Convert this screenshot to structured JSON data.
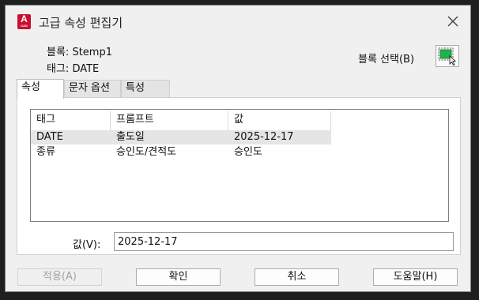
{
  "window": {
    "title": "고급 속성 편집기",
    "app_icon_letter": "A",
    "app_icon_sub": "CAD"
  },
  "info": {
    "block_label": "블록:",
    "block_value": "Stemp1",
    "tag_label": "태그:",
    "tag_value": "DATE"
  },
  "select_block": {
    "label": "블록 선택(B)",
    "icon": "select-objects-icon"
  },
  "tabs": [
    {
      "label": "속성",
      "active": true
    },
    {
      "label": "문자 옵션",
      "active": false
    },
    {
      "label": "특성",
      "active": false
    }
  ],
  "table": {
    "columns": [
      "태그",
      "프롬프트",
      "값"
    ],
    "rows": [
      {
        "tag": "DATE",
        "prompt": "출도일",
        "value": "2025-12-17",
        "selected": true
      },
      {
        "tag": "종류",
        "prompt": "승인도/견적도",
        "value": "승인도",
        "selected": false
      }
    ]
  },
  "value_field": {
    "label": "값(V):",
    "value": "2025-12-17"
  },
  "buttons": {
    "apply": "적용(A)",
    "ok": "확인",
    "cancel": "취소",
    "help": "도움말(H)"
  },
  "colors": {
    "accent_red": "#c8102e",
    "select_icon_green": "#22b14c"
  }
}
